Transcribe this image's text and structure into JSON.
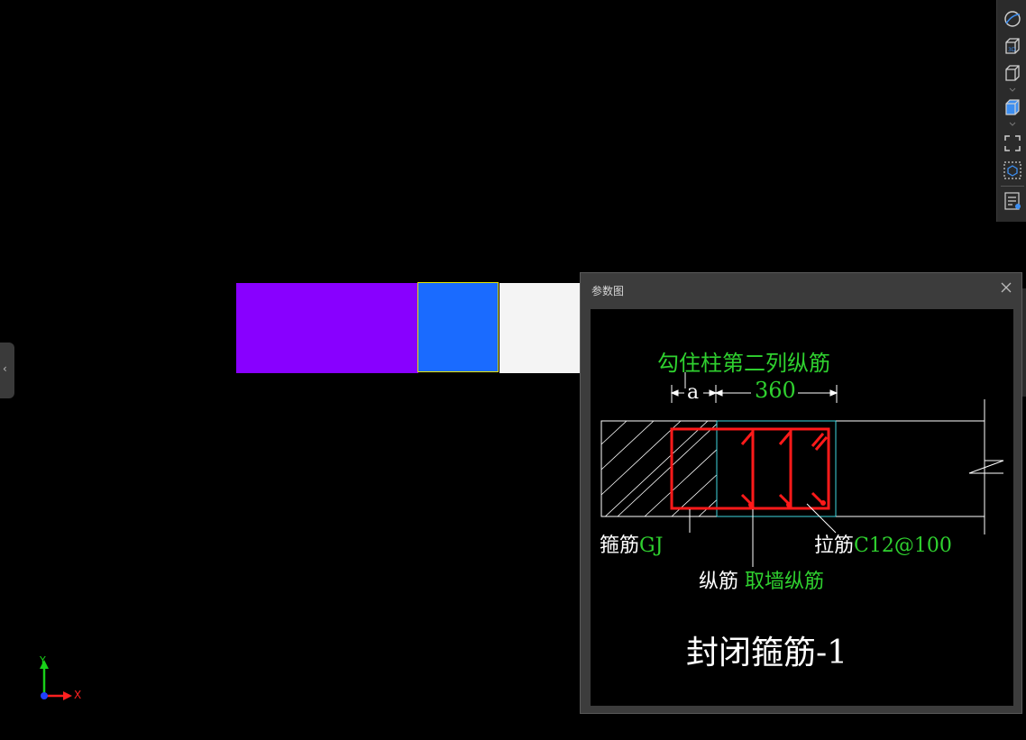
{
  "dialog": {
    "title": "参数图",
    "drawing": {
      "top_note": "勾住柱第二列纵筋",
      "dim_a": "a",
      "dim_value": "360",
      "label_stirrup_prefix": "箍筋",
      "label_stirrup_value": "GJ",
      "label_tie_prefix": "拉筋",
      "label_tie_value": "C12@100",
      "label_long_prefix": "纵筋",
      "label_long_value": "取墙纵筋",
      "caption": "封闭箍筋-1"
    }
  },
  "axis": {
    "x_label": "X",
    "y_label": "Y"
  },
  "colors": {
    "purple_block": "#8800ff",
    "blue_block": "#1a6bff",
    "white_block": "#f4f4f4",
    "selection_outline": "#e6e600",
    "rebar_red": "#ff1a1a",
    "param_green": "#2fd12f",
    "cyan_line": "#3fd7e0",
    "toolbar_icon": "#d0d0d0",
    "toolbar_accent": "#3d8ef0"
  },
  "toolbar": {
    "icons": [
      "orbit-icon",
      "view-3d-icon",
      "view-cube-icon",
      "solid-cube-icon",
      "zoom-extents-icon",
      "select-box-icon",
      "properties-list-icon"
    ]
  }
}
